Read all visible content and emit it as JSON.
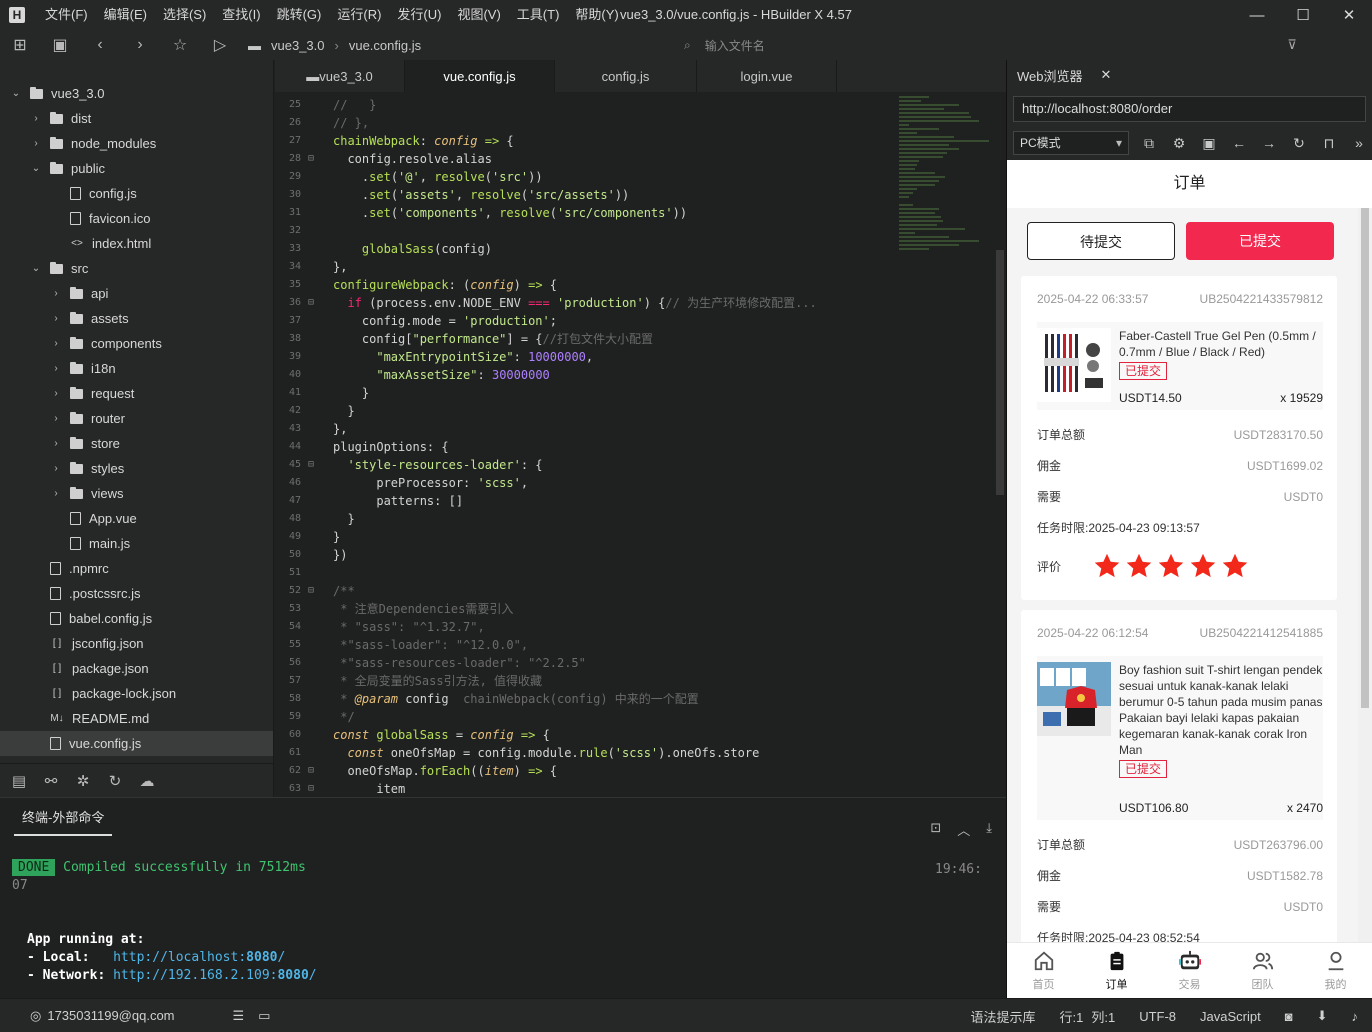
{
  "app": {
    "window_title": "vue3_3.0/vue.config.js - HBuilder X 4.57",
    "menu": [
      "文件(F)",
      "编辑(E)",
      "选择(S)",
      "查找(I)",
      "跳转(G)",
      "运行(R)",
      "发行(U)",
      "视图(V)",
      "工具(T)",
      "帮助(Y)"
    ],
    "logo": "H"
  },
  "toolbar": {
    "path": [
      "vue3_3.0",
      "vue.config.js"
    ],
    "file_search_placeholder": "输入文件名",
    "preview_label": "预览"
  },
  "tree": [
    {
      "depth": 0,
      "type": "folder",
      "open": true,
      "label": "vue3_3.0"
    },
    {
      "depth": 1,
      "type": "folder",
      "open": false,
      "label": "dist"
    },
    {
      "depth": 1,
      "type": "folder",
      "open": false,
      "label": "node_modules"
    },
    {
      "depth": 1,
      "type": "folder",
      "open": true,
      "label": "public"
    },
    {
      "depth": 2,
      "type": "file",
      "icon": "js",
      "label": "config.js"
    },
    {
      "depth": 2,
      "type": "file",
      "icon": "img",
      "label": "favicon.ico"
    },
    {
      "depth": 2,
      "type": "file",
      "icon": "html",
      "label": "index.html"
    },
    {
      "depth": 1,
      "type": "folder",
      "open": true,
      "label": "src"
    },
    {
      "depth": 2,
      "type": "folder",
      "open": false,
      "label": "api"
    },
    {
      "depth": 2,
      "type": "folder",
      "open": false,
      "label": "assets"
    },
    {
      "depth": 2,
      "type": "folder",
      "open": false,
      "label": "components"
    },
    {
      "depth": 2,
      "type": "folder",
      "open": false,
      "label": "i18n"
    },
    {
      "depth": 2,
      "type": "folder",
      "open": false,
      "label": "request"
    },
    {
      "depth": 2,
      "type": "folder",
      "open": false,
      "label": "router"
    },
    {
      "depth": 2,
      "type": "folder",
      "open": false,
      "label": "store"
    },
    {
      "depth": 2,
      "type": "folder",
      "open": false,
      "label": "styles"
    },
    {
      "depth": 2,
      "type": "folder",
      "open": false,
      "label": "views"
    },
    {
      "depth": 2,
      "type": "file",
      "icon": "vue",
      "label": "App.vue"
    },
    {
      "depth": 2,
      "type": "file",
      "icon": "js",
      "label": "main.js"
    },
    {
      "depth": 1,
      "type": "file",
      "icon": "file",
      "label": ".npmrc"
    },
    {
      "depth": 1,
      "type": "file",
      "icon": "js",
      "label": ".postcssrc.js"
    },
    {
      "depth": 1,
      "type": "file",
      "icon": "js",
      "label": "babel.config.js"
    },
    {
      "depth": 1,
      "type": "file",
      "icon": "json",
      "label": "jsconfig.json"
    },
    {
      "depth": 1,
      "type": "file",
      "icon": "json",
      "label": "package.json"
    },
    {
      "depth": 1,
      "type": "file",
      "icon": "json",
      "label": "package-lock.json"
    },
    {
      "depth": 1,
      "type": "file",
      "icon": "md",
      "label": "README.md"
    },
    {
      "depth": 1,
      "type": "file",
      "icon": "js",
      "label": "vue.config.js",
      "selected": true
    }
  ],
  "editor": {
    "tabs": [
      {
        "label": "vue3_3.0",
        "active": false
      },
      {
        "label": "vue.config.js",
        "active": true
      },
      {
        "label": "config.js",
        "active": false
      },
      {
        "label": "login.vue",
        "active": false
      }
    ],
    "lines": [
      {
        "n": "25",
        "fold": "",
        "html": "<span class='tk-com'>//   }</span>"
      },
      {
        "n": "26",
        "fold": "",
        "html": "<span class='tk-com'>// },</span>"
      },
      {
        "n": "27",
        "fold": "",
        "html": "<span class='tk-fn'>chainWebpack</span>: <span class='tk-it'>config</span> <span class='tk-fn'>=&gt;</span> {"
      },
      {
        "n": "28",
        "fold": "⊟",
        "html": "  config.resolve.alias"
      },
      {
        "n": "29",
        "fold": "",
        "html": "    .<span class='tk-fn'>set</span>(<span class='tk-str'>'@'</span>, <span class='tk-fn'>resolve</span>(<span class='tk-str'>'src'</span>))"
      },
      {
        "n": "30",
        "fold": "",
        "html": "    .<span class='tk-fn'>set</span>(<span class='tk-str'>'assets'</span>, <span class='tk-fn'>resolve</span>(<span class='tk-str'>'src/assets'</span>))"
      },
      {
        "n": "31",
        "fold": "",
        "html": "    .<span class='tk-fn'>set</span>(<span class='tk-str'>'components'</span>, <span class='tk-fn'>resolve</span>(<span class='tk-str'>'src/components'</span>))"
      },
      {
        "n": "32",
        "fold": "",
        "html": ""
      },
      {
        "n": "33",
        "fold": "",
        "html": "    <span class='tk-fn'>globalSass</span>(config)"
      },
      {
        "n": "34",
        "fold": "",
        "html": "},"
      },
      {
        "n": "35",
        "fold": "",
        "html": "<span class='tk-fn'>configureWebpack</span>: (<span class='tk-it'>config</span>) <span class='tk-fn'>=&gt;</span> {"
      },
      {
        "n": "36",
        "fold": "⊟",
        "html": "  <span class='tk-ctrl'>if</span> (process.env.NODE_ENV <span class='tk-ctrl'>===</span> <span class='tk-str'>'production'</span>) {<span class='tk-com'>// 为生产环境修改配置...</span>"
      },
      {
        "n": "37",
        "fold": "",
        "html": "    config.mode = <span class='tk-str'>'production'</span>;"
      },
      {
        "n": "38",
        "fold": "",
        "html": "    config[<span class='tk-str'>\"performance\"</span>] = {<span class='tk-com'>//打包文件大小配置</span>"
      },
      {
        "n": "39",
        "fold": "",
        "html": "      <span class='tk-str'>\"maxEntrypointSize\"</span>: <span class='tk-num'>10000000</span>,"
      },
      {
        "n": "40",
        "fold": "",
        "html": "      <span class='tk-str'>\"maxAssetSize\"</span>: <span class='tk-num'>30000000</span>"
      },
      {
        "n": "41",
        "fold": "",
        "html": "    }"
      },
      {
        "n": "42",
        "fold": "",
        "html": "  }"
      },
      {
        "n": "43",
        "fold": "",
        "html": "},"
      },
      {
        "n": "44",
        "fold": "",
        "html": "pluginOptions: {"
      },
      {
        "n": "45",
        "fold": "⊟",
        "html": "  <span class='tk-str'>'style-resources-loader'</span>: {"
      },
      {
        "n": "46",
        "fold": "",
        "html": "      preProcessor: <span class='tk-str'>'scss'</span>,"
      },
      {
        "n": "47",
        "fold": "",
        "html": "      patterns: []"
      },
      {
        "n": "48",
        "fold": "",
        "html": "  }"
      },
      {
        "n": "49",
        "fold": "",
        "html": "}"
      },
      {
        "n": "50",
        "fold": "",
        "html": "})"
      },
      {
        "n": "51",
        "fold": "",
        "html": ""
      },
      {
        "n": "52",
        "fold": "⊟",
        "html": "<span class='tk-com'>/**</span>"
      },
      {
        "n": "53",
        "fold": "",
        "html": "<span class='tk-com'> * 注意Dependencies需要引入</span>"
      },
      {
        "n": "54",
        "fold": "",
        "html": "<span class='tk-com'> * \"sass\": \"^1.32.7\",</span>"
      },
      {
        "n": "55",
        "fold": "",
        "html": "<span class='tk-com'> *\"sass-loader\": \"^12.0.0\",</span>"
      },
      {
        "n": "56",
        "fold": "",
        "html": "<span class='tk-com'> *\"sass-resources-loader\": \"^2.2.5\"</span>"
      },
      {
        "n": "57",
        "fold": "",
        "html": "<span class='tk-com'> * 全局变量的Sass引方法, 值得收藏</span>"
      },
      {
        "n": "58",
        "fold": "",
        "html": "<span class='tk-com'> * </span><span class='tk-it'>@param</span> config  <span class='tk-com'>chainWebpack(config) 中来的一个配置</span>"
      },
      {
        "n": "59",
        "fold": "",
        "html": "<span class='tk-com'> */</span>"
      },
      {
        "n": "60",
        "fold": "",
        "html": "<span class='tk-it'>const</span> <span class='tk-fn'>globalSass</span> = <span class='tk-it'>config</span> <span class='tk-fn'>=&gt;</span> {"
      },
      {
        "n": "61",
        "fold": "",
        "html": "  <span class='tk-it'>const</span> oneOfsMap = config.module.<span class='tk-fn'>rule</span>(<span class='tk-str'>'scss'</span>).oneOfs.store"
      },
      {
        "n": "62",
        "fold": "⊟",
        "html": "  oneOfsMap.<span class='tk-fn'>forEach</span>((<span class='tk-it'>item</span>) <span class='tk-fn'>=&gt;</span> {"
      },
      {
        "n": "63",
        "fold": "⊟",
        "html": "      item"
      }
    ]
  },
  "terminal": {
    "tab_label": "终端-外部命令",
    "done_label": "DONE",
    "compiled_msg": "Compiled successfully in 7512ms",
    "time_a": "19:46:",
    "time_b": "07",
    "running_label": "App running at:",
    "local_label": "- Local:",
    "local_url": "http://localhost:",
    "local_port": "8080",
    "local_tail": "/",
    "network_label": "- Network:",
    "network_url": "http://192.168.2.109:",
    "network_port": "8080",
    "network_tail": "/"
  },
  "statusbar": {
    "account": "1735031199@qq.com",
    "hint": "语法提示库",
    "row": "行:1",
    "col": "列:1",
    "encoding": "UTF-8",
    "language": "JavaScript"
  },
  "browser": {
    "tab_label": "Web浏览器",
    "url": "http://localhost:8080/order",
    "mode": "PC模式",
    "page_title": "订单",
    "tab_pending": "待提交",
    "tab_submitted": "已提交",
    "orders": [
      {
        "date": "2025-04-22 06:33:57",
        "order_no": "UB2504221433579812",
        "product": "Faber-Castell True Gel Pen (0.5mm / 0.7mm / Blue / Black / Red)",
        "status": "已提交",
        "price": "USDT14.50",
        "qty": "x 19529",
        "total_label": "订单总额",
        "total": "USDT283170.50",
        "commission_label": "佣金",
        "commission": "USDT1699.02",
        "need_label": "需要",
        "need": "USDT0",
        "deadline_label": "任务时限:",
        "deadline": "2025-04-23 09:13:57",
        "rating_label": "评价",
        "rating": 5
      },
      {
        "date": "2025-04-22 06:12:54",
        "order_no": "UB2504221412541885",
        "product": "Boy fashion suit T-shirt lengan pendek sesuai untuk kanak-kanak lelaki berumur 0-5 tahun pada musim panas Pakaian bayi lelaki kapas pakaian kegemaran kanak-kanak corak Iron Man",
        "status": "已提交",
        "price": "USDT106.80",
        "qty": "x 2470",
        "total_label": "订单总额",
        "total": "USDT263796.00",
        "commission_label": "佣金",
        "commission": "USDT1582.78",
        "need_label": "需要",
        "need": "USDT0",
        "deadline_label": "任务时限:",
        "deadline": "2025-04-23 08:52:54"
      }
    ],
    "nav": [
      {
        "label": "首页",
        "icon": "home-icon",
        "active": false
      },
      {
        "label": "订单",
        "icon": "clipboard-icon",
        "active": true
      },
      {
        "label": "交易",
        "icon": "robot-icon",
        "active": false
      },
      {
        "label": "团队",
        "icon": "team-icon",
        "active": false
      },
      {
        "label": "我的",
        "icon": "user-icon",
        "active": false
      }
    ]
  },
  "colors": {
    "accent_red": "#f2284f",
    "done_green": "#2fa25b"
  }
}
